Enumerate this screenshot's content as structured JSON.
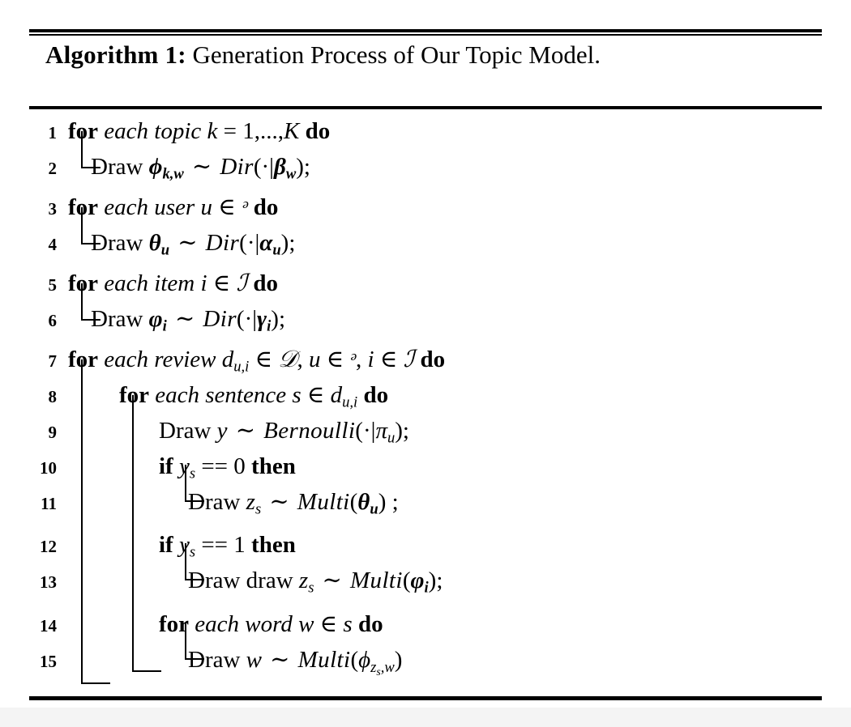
{
  "document": {
    "kind": "algorithm-float",
    "caption": {
      "label": "Algorithm 1:",
      "title": "Generation Process of Our Topic Model."
    }
  },
  "algorithm": {
    "lines": [
      {
        "no": "1",
        "indent": 0,
        "type": "for",
        "text": "for each topic k = 1,...,K do",
        "parts": {
          "kw_for": "for",
          "cond": "each topic",
          "var": "k",
          "eq": "=",
          "range": "1,...,",
          "upper": "K",
          "kw_do": "do"
        }
      },
      {
        "no": "2",
        "indent": 1,
        "type": "draw",
        "text": "Draw ϕ_{k,w} ~ Dir(·|β_w);",
        "parts": {
          "verb": "Draw",
          "lhs": "ϕ",
          "lhs_sub": "k,w",
          "rel": "∼",
          "dist": "Dir",
          "arg": "·|",
          "param": "β",
          "param_sub": "w",
          "term": ";"
        }
      },
      {
        "no": "3",
        "indent": 0,
        "type": "for",
        "text": "for each user u ∈ ᵊ do",
        "parts": {
          "kw_for": "for",
          "cond": "each user",
          "var": "u",
          "in": "∈",
          "set": "ᵊ",
          "kw_do": "do"
        }
      },
      {
        "no": "4",
        "indent": 1,
        "type": "draw",
        "text": "Draw θ_u ~ Dir(·|α_u);",
        "parts": {
          "verb": "Draw",
          "lhs": "θ",
          "lhs_sub": "u",
          "rel": "∼",
          "dist": "Dir",
          "arg": "·|",
          "param": "α",
          "param_sub": "u",
          "term": ";"
        }
      },
      {
        "no": "5",
        "indent": 0,
        "type": "for",
        "text": "for each item i ∈ ℐ do",
        "parts": {
          "kw_for": "for",
          "cond": "each item",
          "var": "i",
          "in": "∈",
          "set": "ℐ",
          "kw_do": "do"
        }
      },
      {
        "no": "6",
        "indent": 1,
        "type": "draw",
        "text": "Draw φ_i ~ Dir(·|γ_i);",
        "parts": {
          "verb": "Draw",
          "lhs": "φ",
          "lhs_sub": "i",
          "rel": "∼",
          "dist": "Dir",
          "arg": "·|",
          "param": "γ",
          "param_sub": "i",
          "term": ";"
        }
      },
      {
        "no": "7",
        "indent": 0,
        "type": "for",
        "text": "for each review d_{u,i} ∈ 𝒟, u ∈ ᵊ, i ∈ ℐ do",
        "parts": {
          "kw_for": "for",
          "cond": "each review",
          "var": "d",
          "var_sub": "u,i",
          "in": "∈",
          "set1": "𝒟",
          "var2": "u",
          "set2": "ᵊ",
          "var3": "i",
          "set3": "ℐ",
          "kw_do": "do"
        }
      },
      {
        "no": "8",
        "indent": 1,
        "type": "for",
        "text": "for each sentence s ∈ d_{u,i} do",
        "parts": {
          "kw_for": "for",
          "cond": "each sentence",
          "var": "s",
          "in": "∈",
          "set": "d",
          "set_sub": "u,i",
          "kw_do": "do"
        }
      },
      {
        "no": "9",
        "indent": 2,
        "type": "draw",
        "text": "Draw y ~ Bernoulli(·|π_u);",
        "parts": {
          "verb": "Draw",
          "lhs": "y",
          "rel": "∼",
          "dist": "Bernoulli",
          "arg": "·|",
          "param": "π",
          "param_sub": "u",
          "term": ";"
        }
      },
      {
        "no": "10",
        "indent": 2,
        "type": "if",
        "text": "if y_s == 0 then",
        "parts": {
          "kw_if": "if",
          "var": "y",
          "var_sub": "s",
          "op": "==",
          "value": "0",
          "kw_then": "then"
        }
      },
      {
        "no": "11",
        "indent": 3,
        "type": "draw",
        "text": "Draw z_s ~ Multi(θ_u) ;",
        "parts": {
          "verb": "Draw",
          "lhs": "z",
          "lhs_sub": "s",
          "rel": "∼",
          "dist": "Multi",
          "param": "θ",
          "param_sub": "u",
          "term": " ;"
        }
      },
      {
        "no": "12",
        "indent": 2,
        "type": "if",
        "text": "if y_s == 1 then",
        "parts": {
          "kw_if": "if",
          "var": "y",
          "var_sub": "s",
          "op": "==",
          "value": "1",
          "kw_then": "then"
        }
      },
      {
        "no": "13",
        "indent": 3,
        "type": "draw",
        "text": "Draw draw z_s ~ Multi(φ_i);",
        "parts": {
          "verb": "Draw draw",
          "lhs": "z",
          "lhs_sub": "s",
          "rel": "∼",
          "dist": "Multi",
          "param": "φ",
          "param_sub": "i",
          "term": ";"
        }
      },
      {
        "no": "14",
        "indent": 2,
        "type": "for",
        "text": "for each word w ∈ s do",
        "parts": {
          "kw_for": "for",
          "cond": "each word",
          "var": "w",
          "in": "∈",
          "set": "s",
          "kw_do": "do"
        }
      },
      {
        "no": "15",
        "indent": 3,
        "type": "draw",
        "text": "Draw w ~ Multi(ϕ_{z_s,w})",
        "parts": {
          "verb": "Draw",
          "lhs": "w",
          "rel": "∼",
          "dist": "Multi",
          "param": "ϕ",
          "param_sub": "z",
          "param_subsub": "s",
          "param_sub2": ",w",
          "term": ""
        }
      }
    ]
  },
  "symbols": {
    "tilde": "∼",
    "element_of": "∈",
    "cdot": "·",
    "mid": "|"
  },
  "colors": {
    "ink": "#000000",
    "page": "#ffffff",
    "margin": "#f4f4f4"
  }
}
